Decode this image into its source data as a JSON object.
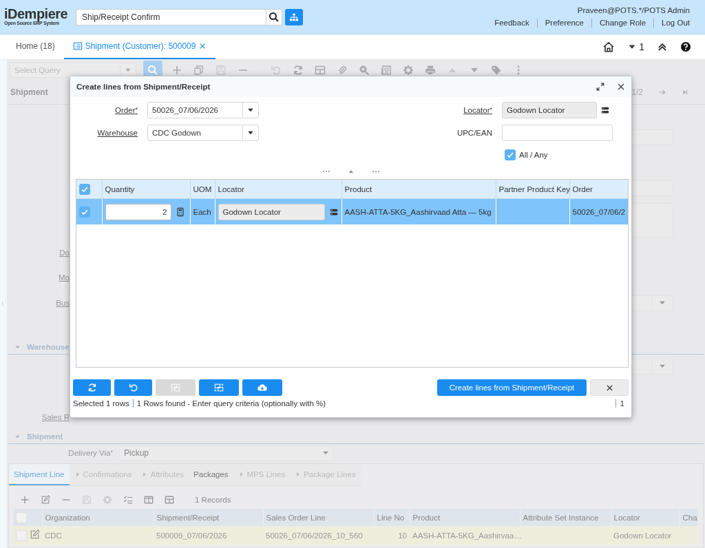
{
  "header": {
    "logo": "iDempiere",
    "logo_tagline": "Open Source ERP System",
    "search_value": "Ship/Receipt Confirm",
    "user": "Praveen@POTS.*/POTS Admin",
    "links": [
      "Feedback",
      "Preference",
      "Change Role",
      "Log Out"
    ]
  },
  "window_tabs": [
    {
      "label": "Home (18)",
      "selected": false,
      "closable": false
    },
    {
      "label": "Shipment (Customer): 500009",
      "selected": true,
      "closable": true
    }
  ],
  "open_windows_count": "1",
  "toolbar": {
    "query_placeholder": "Select Query"
  },
  "form": {
    "title": "Shipment",
    "record_position": "1/2",
    "labels": [
      "Do",
      "Mo",
      "Bus"
    ],
    "sales_label": "Sales R",
    "sections": [
      {
        "title": "Warehouse",
        "expanded": true
      },
      {
        "title": "Shipment",
        "expanded": true
      }
    ],
    "delivery": {
      "label": "Delivery Via",
      "required_mark": "*",
      "value": "Pickup"
    }
  },
  "detail": {
    "tabs": [
      {
        "label": "Shipment Line",
        "selected": true,
        "disabled": false
      },
      {
        "label": "Confirmations",
        "selected": false,
        "disabled": true
      },
      {
        "label": "Attributes",
        "selected": false,
        "disabled": true
      },
      {
        "label": "Packages",
        "selected": false,
        "disabled": false
      },
      {
        "label": "MPS Lines",
        "selected": false,
        "disabled": true
      },
      {
        "label": "Package Lines",
        "selected": false,
        "disabled": true
      }
    ],
    "record_count": "1 Records",
    "all_checked": false,
    "columns": [
      "Organization",
      "Shipment/Receipt",
      "Sales Order Line",
      "Line No",
      "Product",
      "Attribute Set Instance",
      "Locator",
      "Cha"
    ],
    "rows": [
      {
        "checked": false,
        "cells": [
          "CDC",
          "500009_07/06/2026",
          "50026_07/06/2026_10_560",
          "10",
          "AASH-ATTA-5KG_Aashirvaa…",
          null,
          "Godown Locator"
        ]
      }
    ]
  },
  "dialog": {
    "title": "Create lines from Shipment/Receipt",
    "fields": [
      {
        "label": "Order",
        "required_mark": "*",
        "link": true,
        "kind": "dropdown",
        "value": "50026_07/06/2026"
      },
      {
        "label": "Locator",
        "required_mark": "*",
        "link": true,
        "kind": "search",
        "value": "Godown Locator"
      },
      {
        "label": "Warehouse",
        "link": true,
        "kind": "dropdown",
        "value": "CDC Godown"
      },
      {
        "label": "UPC/EAN",
        "link": false,
        "kind": "text"
      }
    ],
    "match_all": {
      "label": "All / Any",
      "checked": true
    },
    "table": {
      "all_checked": true,
      "columns": [
        "Quantity",
        "UOM",
        "Locator",
        "Product",
        "Partner Product Key",
        "Order"
      ],
      "rows": [
        {
          "selected": true,
          "checked": true,
          "quantity": "2",
          "uom": "Each",
          "locator": "Godown Locator",
          "product": "AASH-ATTA-5KG_Aashirvaad Atta — 5kg",
          "order": "50026_07/06/2"
        }
      ]
    },
    "action_buttons": [
      {
        "kind": "refresh",
        "disabled": false
      },
      {
        "kind": "reset",
        "disabled": false
      },
      {
        "kind": "select",
        "disabled": true
      },
      {
        "kind": "zoom",
        "disabled": false
      },
      {
        "kind": "export",
        "disabled": false
      }
    ],
    "ok_label": "Create lines from Shipment/Receipt",
    "status": {
      "selected": "Selected 1 rows",
      "message": "1 Rows found - Enter query criteria (optionally with %)",
      "page": "1"
    }
  }
}
